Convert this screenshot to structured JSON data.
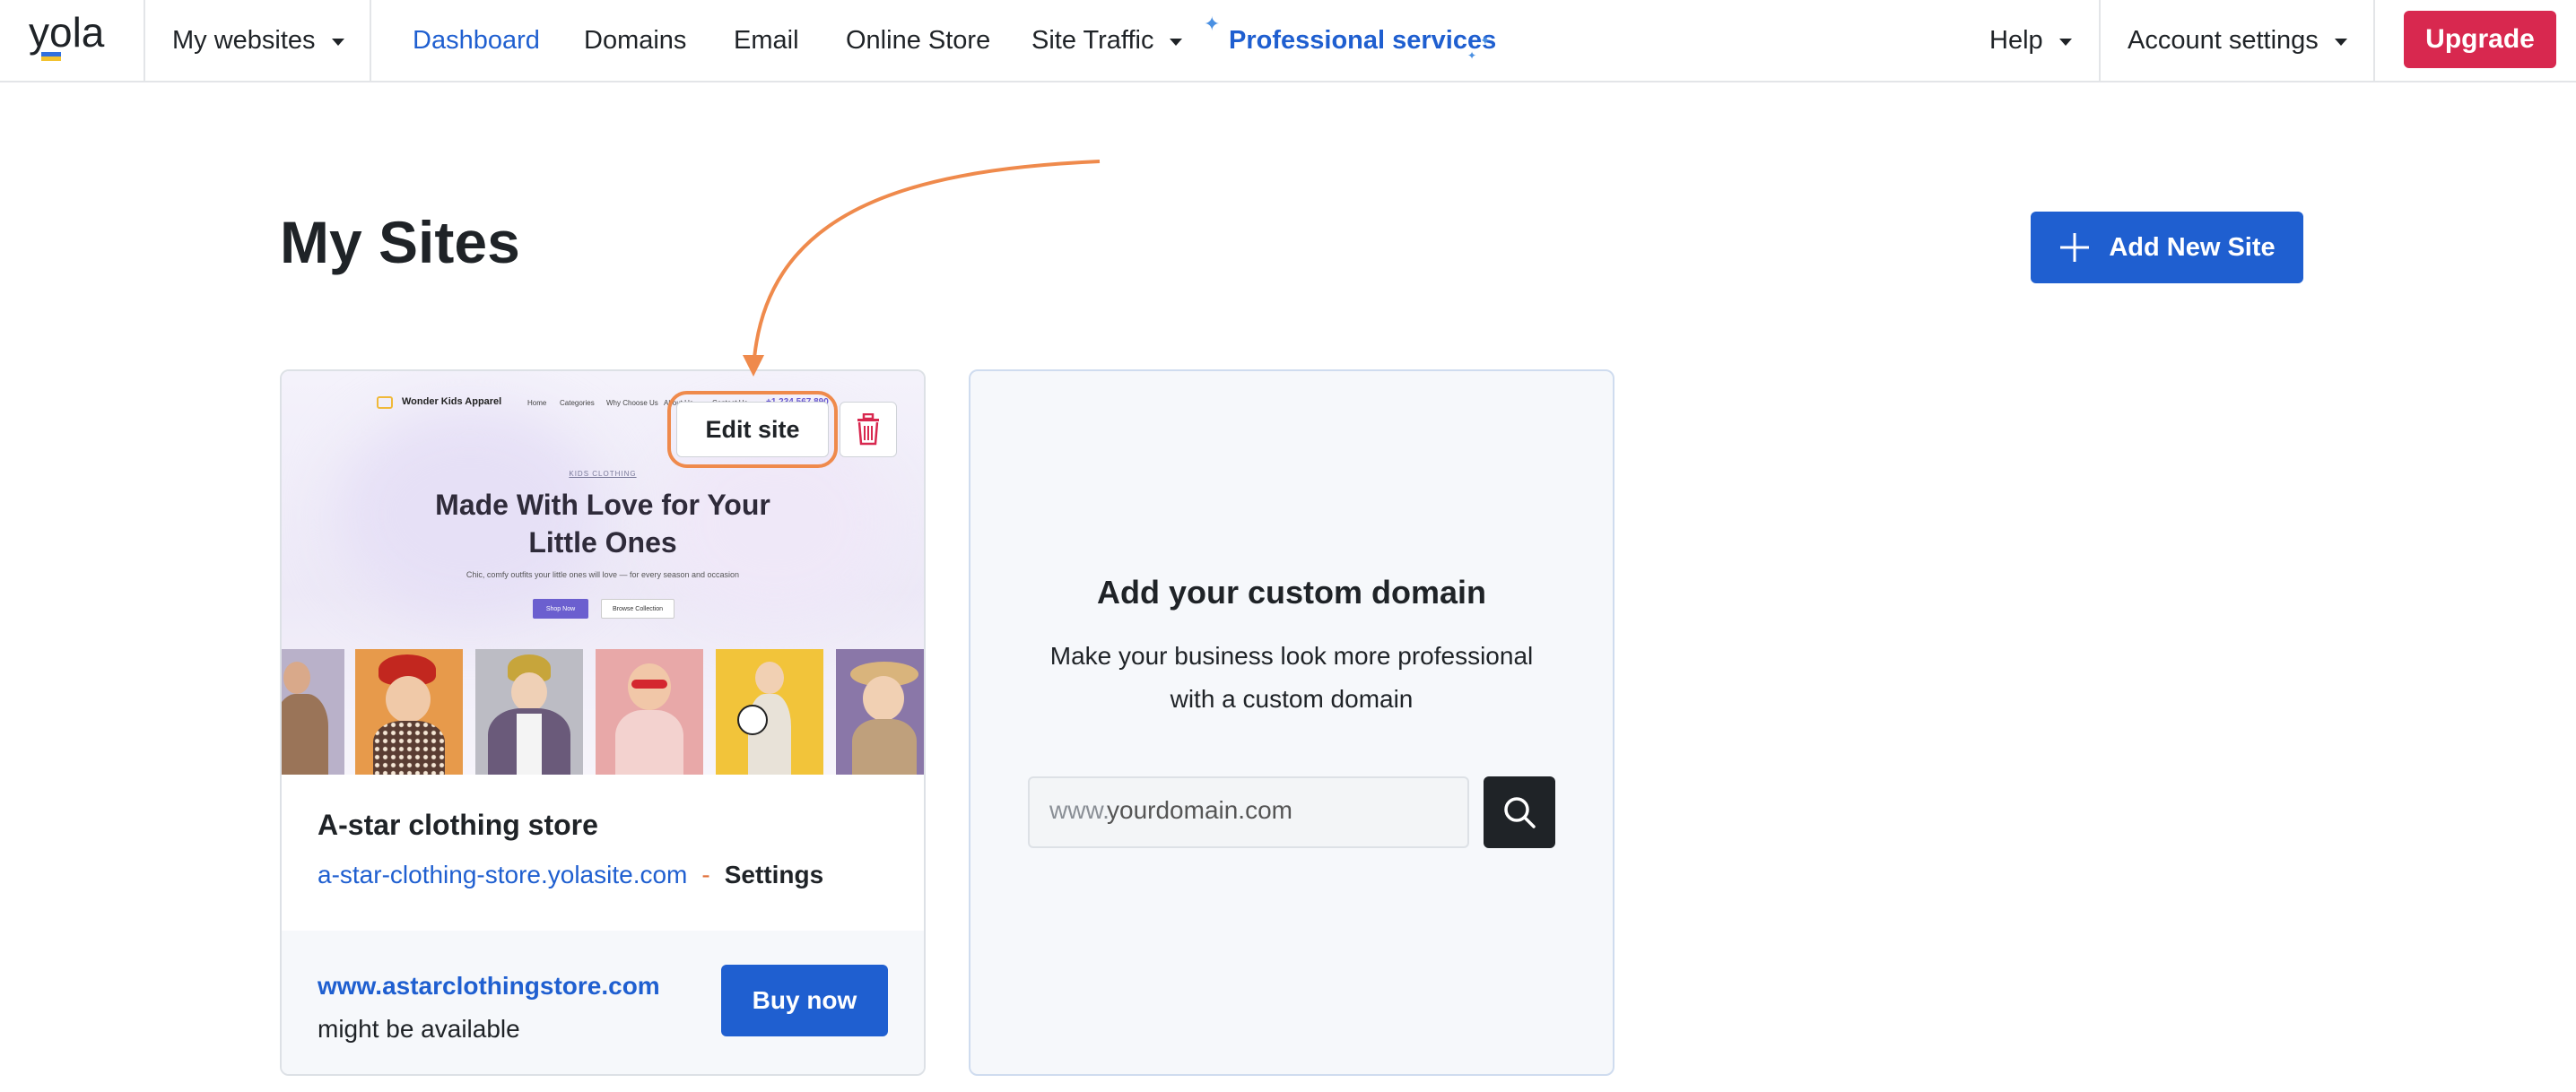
{
  "nav": {
    "logo_text": "yola",
    "my_websites": "My websites",
    "items": [
      "Dashboard",
      "Domains",
      "Email",
      "Online Store",
      "Site Traffic",
      "Professional services"
    ],
    "help": "Help",
    "account": "Account settings",
    "upgrade": "Upgrade"
  },
  "header": {
    "title": "My Sites",
    "add_site": "Add New Site"
  },
  "site": {
    "edit_label": "Edit site",
    "name": "A-star clothing store",
    "url": "a-star-clothing-store.yolasite.com",
    "separator": "-",
    "settings": "Settings",
    "offer_domain": "www.astarclothingstore.com",
    "offer_availability": "might be available",
    "buy_label": "Buy now",
    "preview": {
      "brand": "Wonder Kids Apparel",
      "links": [
        "Home",
        "Categories",
        "Why Choose Us",
        "About Us",
        "Contact Us"
      ],
      "phone": "+1 234 567 890",
      "kicker": "KIDS CLOTHING",
      "headline_1": "Made With Love for Your",
      "headline_2": "Little Ones",
      "subline": "Chic, comfy outfits your little ones will love — for every season and occasion",
      "cta_primary": "Shop Now",
      "cta_secondary": "Browse Collection"
    }
  },
  "domain_card": {
    "title": "Add your custom domain",
    "desc_line1": "Make your business look more professional",
    "desc_line2": "with a custom domain",
    "input_prefix": "www.",
    "input_value": "yourdomain.com"
  },
  "colors": {
    "brand_blue": "#1f5fd0",
    "upgrade_red": "#d8284f",
    "annotation_orange": "#ef8a4c"
  },
  "icons": {
    "add": "plus-icon",
    "delete": "trash-icon",
    "search": "search-icon",
    "caret": "chevron-down-icon"
  }
}
